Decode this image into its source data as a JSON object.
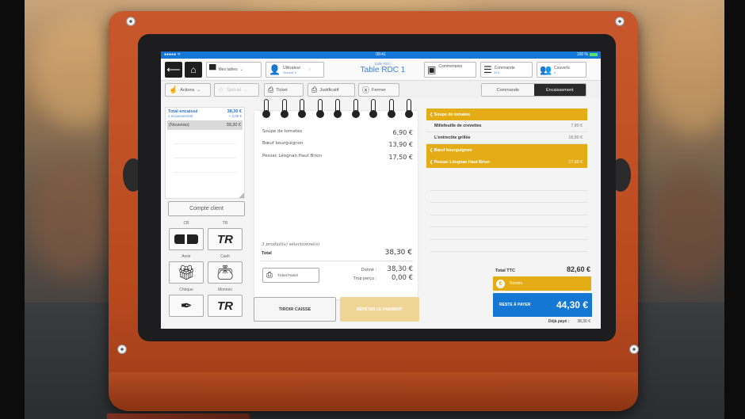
{
  "status_bar": {
    "carrier": "●●●●● ᯤ",
    "time": "09:41",
    "battery": "100 %"
  },
  "header": {
    "back_icon": "arrow-left-icon",
    "home_icon": "home-icon",
    "tables_label": "Mes tables",
    "user_label": "Utilisateur",
    "user_name": "Vincent V",
    "room": "Salle RDC",
    "table": "Table RDC 1",
    "comment_label": "Commentaire",
    "order_label": "Commande",
    "order_number": "N°4",
    "covers_label": "Couverts",
    "covers_count": "2"
  },
  "toolbar": {
    "actions": "Actions",
    "special": "Spécial",
    "ticket": "Ticket",
    "justificatif": "Justificatif",
    "fermer": "Fermer",
    "tabs": [
      {
        "label": "Commande",
        "active": false
      },
      {
        "label": "Encaissement",
        "active": true
      }
    ]
  },
  "payments": {
    "total_label": "Total encaissé",
    "total_value": "38,30 €",
    "count_label": "1 encaissement",
    "count_value": "+ 0,00 €",
    "entries": [
      {
        "label": "(Nouveau)",
        "value": "38,30 €"
      }
    ],
    "customer_account": "Compte client",
    "methods": [
      {
        "label": "CB",
        "icon": "credit-card-icon"
      },
      {
        "label": "TR",
        "icon": "tr-icon"
      },
      {
        "label": "Avoir",
        "icon": "gift-icon"
      },
      {
        "label": "Cash",
        "icon": "wallet-icon"
      },
      {
        "label": "Chèque",
        "icon": "pen-icon"
      },
      {
        "label": "Monnéo",
        "icon": "tr-icon"
      }
    ]
  },
  "ticket": {
    "items": [
      {
        "name": "Soupe de tomates",
        "price": "6,90 €"
      },
      {
        "name": "Bœuf bourguignon",
        "price": "13,90 €"
      },
      {
        "name": "Pessac Léognan Haut Brion",
        "price": "17,50 €"
      }
    ],
    "selected_count": "3 produit(s) sélectionné(s)",
    "total_label": "Total",
    "total_value": "38,30 €",
    "partial_ticket": "Ticket Partiel",
    "given_label": "Donné :",
    "given_value": "38,30 €",
    "overpaid_label": "Trop perçu :",
    "overpaid_value": "0,00 €",
    "drawer_button": "TIROIR CAISSE",
    "repeat_button": "RÉPÉTER LE PAIEMENT"
  },
  "order": {
    "items": [
      {
        "name": "Soupe de tomates",
        "price": "",
        "selected": true
      },
      {
        "name": "Millefeuille de crevettes",
        "price": "7,90 €",
        "selected": false
      },
      {
        "name": "L'entrecôte grillée",
        "price": "18,90 €",
        "selected": false
      },
      {
        "name": "Bœuf bourguignon",
        "price": "",
        "selected": true
      },
      {
        "name": "Pessac Léognan Haut Brion",
        "price": "17,50 €",
        "selected": true
      }
    ],
    "total_ttc_label": "Total TTC",
    "total_ttc_value": "82,60 €",
    "refund_label": "Rembo",
    "remaining_label": "RESTE À PAYER",
    "remaining_value": "44,30 €",
    "paid_label": "Déjà payé :",
    "paid_value": "38,30 €"
  },
  "colors": {
    "accent_blue": "#1477d4",
    "accent_yellow": "#e4ad15",
    "stand_orange": "#c8572c"
  }
}
